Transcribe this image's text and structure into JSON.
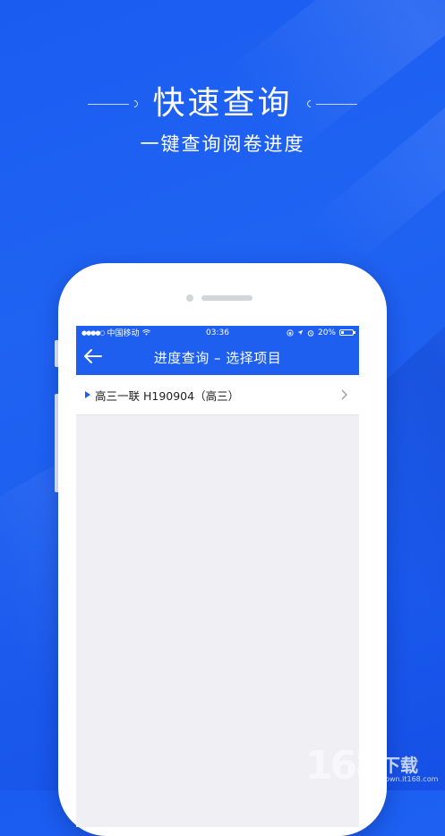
{
  "promo": {
    "headline": "快速查询",
    "subtitle": "一键查询阅卷进度"
  },
  "status_bar": {
    "signal": "●●●●○",
    "carrier": "中国移动",
    "wifi_icon": "wifi-icon",
    "time": "03:36",
    "battery": "20%"
  },
  "nav": {
    "back_icon": "arrow-left-icon",
    "title": "进度查询 – 选择项目"
  },
  "projects": [
    {
      "label": "高三一联 H190904（高三）",
      "chevron_icon": "chevron-right-icon"
    }
  ],
  "watermark": {
    "digits": "168",
    "text": "下载",
    "url": "down.it168.com"
  },
  "colors": {
    "brand_blue": "#1e5ff0",
    "background_blue": "#1a5cf0",
    "screen_bg": "#efeff4"
  }
}
